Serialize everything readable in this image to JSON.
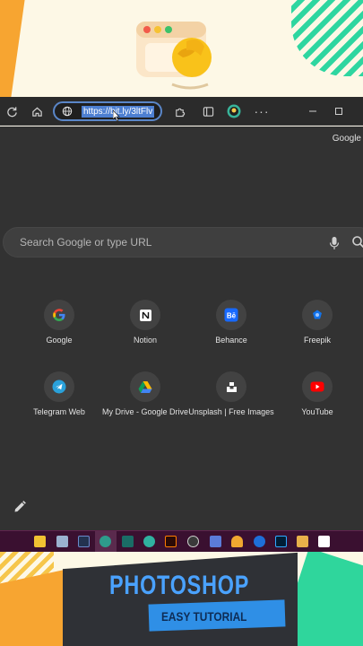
{
  "browser": {
    "url_selected": "https://bit.ly/3ltFlv",
    "toolbar_icons": [
      "refresh-icon",
      "home-icon",
      "globe-icon",
      "extensions-icon",
      "sidebar-icon",
      "profile-icon",
      "more-icon",
      "minimize-icon",
      "maximize-icon"
    ]
  },
  "newtab": {
    "google_link": "Google",
    "search_placeholder": "Search Google or type URL",
    "shortcuts": [
      {
        "label": "Google",
        "icon": "google-icon",
        "color": "#ea4335"
      },
      {
        "label": "Notion",
        "icon": "notion-icon",
        "color": "#ffffff"
      },
      {
        "label": "Behance",
        "icon": "behance-icon",
        "color": "#1769ff"
      },
      {
        "label": "Freepik",
        "icon": "freepik-icon",
        "color": "#1273eb"
      },
      {
        "label": "Telegram Web",
        "icon": "telegram-icon",
        "color": "#2aa1da"
      },
      {
        "label": "My Drive - Google Drive",
        "icon": "google-drive-icon",
        "color": "#0f9d58"
      },
      {
        "label": "Unsplash | Free Images",
        "icon": "unsplash-icon",
        "color": "#ffffff"
      },
      {
        "label": "YouTube",
        "icon": "youtube-icon",
        "color": "#ff0000"
      }
    ]
  },
  "thumbnail": {
    "title": "PHOTOSHOP",
    "tag": "EASY TUTORIAL"
  },
  "colors": {
    "page_bg": "#323232",
    "accent_blue": "#4d7fd1",
    "taskbar": "#3a1030"
  }
}
